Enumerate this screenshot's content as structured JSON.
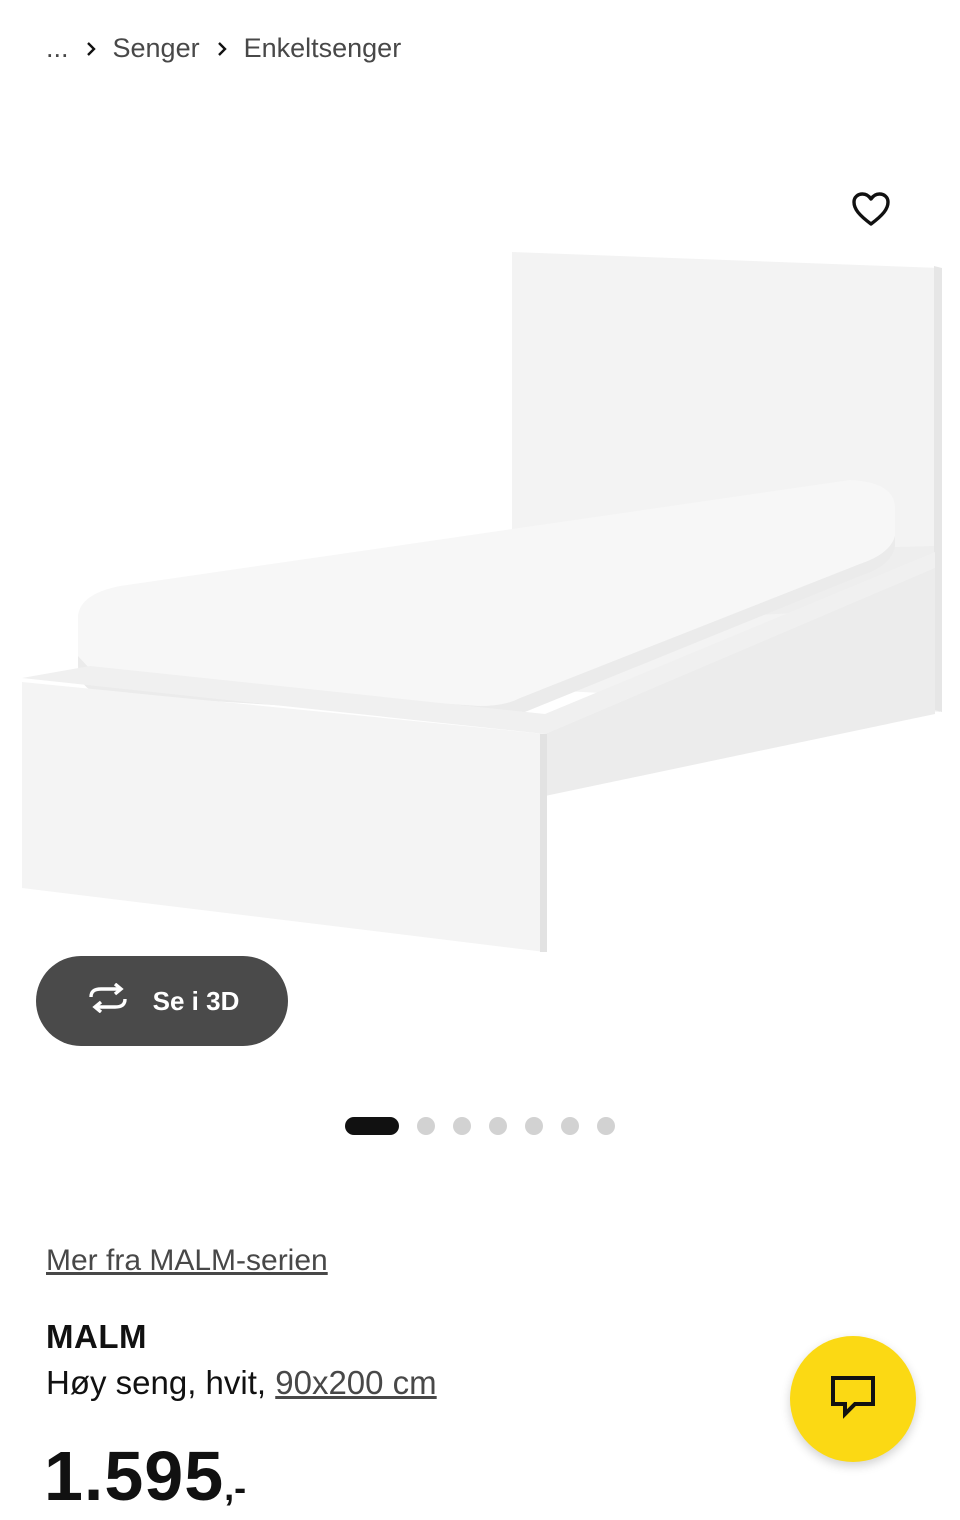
{
  "breadcrumb": {
    "ellipsis": "...",
    "items": [
      "Senger",
      "Enkeltsenger"
    ]
  },
  "favorite": {
    "icon": "heart-icon"
  },
  "gallery": {
    "view_3d_label": "Se i 3D",
    "view_3d_icon": "rotate-3d-icon",
    "slide_count": 7,
    "active_slide": 1
  },
  "product": {
    "series_link": "Mer fra MALM-serien",
    "name": "MALM",
    "description": "Høy seng, hvit,",
    "size": "90x200 cm",
    "price": "1.595",
    "price_suffix": ",-"
  },
  "chat": {
    "icon": "chat-icon",
    "color": "#fbd914"
  },
  "colors": {
    "text": "#111111",
    "muted": "#484848",
    "button_dark": "#4a4a4a",
    "dot_inactive": "#d2d2d2"
  }
}
